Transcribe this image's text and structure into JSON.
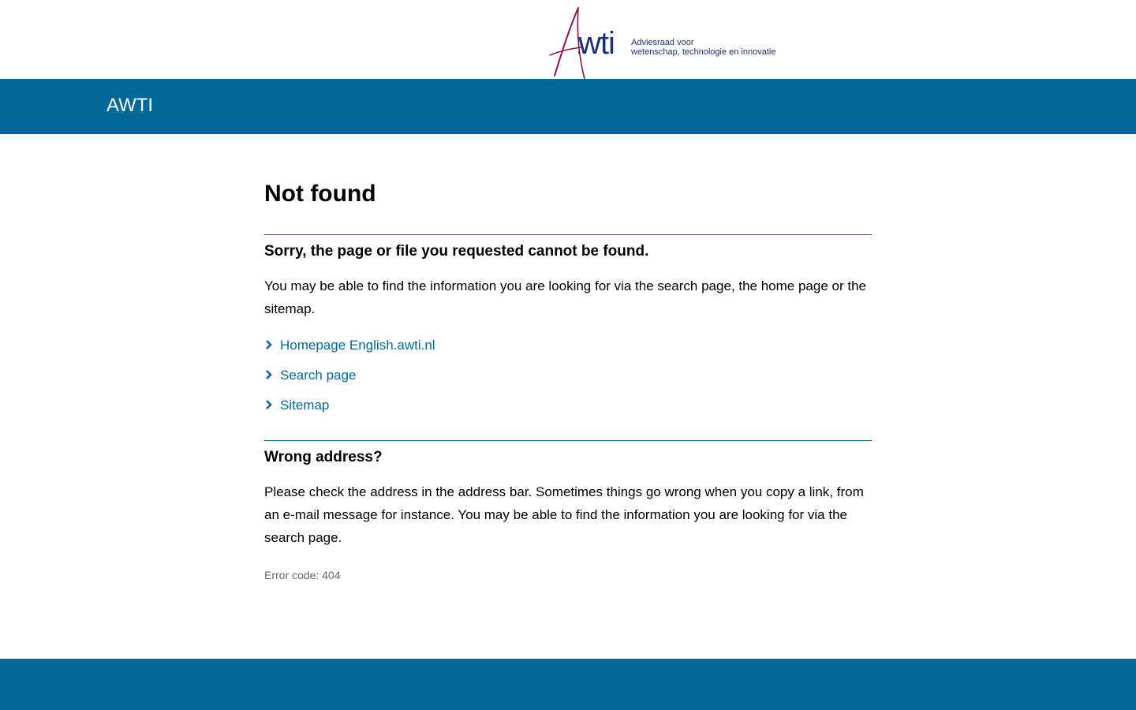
{
  "header": {
    "logo": {
      "wordmark": "Awti",
      "tagline_line1": "Adviesraad voor",
      "tagline_line2": "wetenschap, technologie en innovatie"
    },
    "site_name": "AWTI"
  },
  "colors": {
    "primary": "#01689b",
    "logo_blue": "#1b2f7a",
    "logo_red": "#8b1548",
    "muted_text": "#696969"
  },
  "main": {
    "title": "Not found",
    "section1": {
      "heading": "Sorry, the page or file you requested cannot be found.",
      "body": "You may be able to find the information you are looking for via the search page, the home page or the sitemap.",
      "links": [
        {
          "icon": "chevron-right-icon",
          "label": "Homepage English.awti.nl"
        },
        {
          "icon": "chevron-right-icon",
          "label": "Search page"
        },
        {
          "icon": "chevron-right-icon",
          "label": "Sitemap"
        }
      ]
    },
    "section2": {
      "heading": "Wrong address?",
      "body": "Please check the address in the address bar. Sometimes things go wrong when you copy a link, from an e-mail message for instance. You may be able to find the information you are looking for via the search page."
    },
    "error_code": "Error code: 404"
  }
}
